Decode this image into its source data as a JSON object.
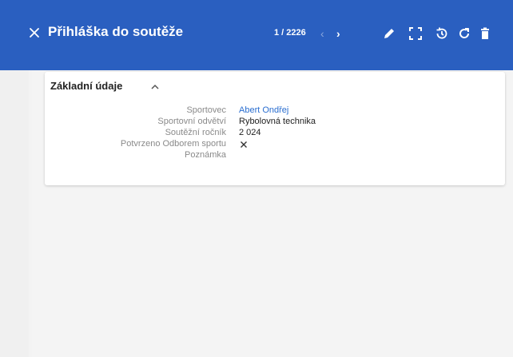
{
  "header": {
    "title": "Přihláška do soutěže",
    "counter": "1 / 2226",
    "prev_icon": "chevron-left-icon",
    "next_icon": "chevron-right-icon",
    "actions": [
      "edit-pencil-icon",
      "expand-icon",
      "history-icon",
      "refresh-icon",
      "delete-icon"
    ],
    "accent_color": "#2a5fc0"
  },
  "section": {
    "title": "Základní údaje",
    "toggle_icon": "chevron-up-icon",
    "rows": [
      {
        "label": "Sportovec",
        "value": "Abert Ondřej"
      },
      {
        "label": "Sportovní odvětví",
        "value": "Rybolovná technika"
      },
      {
        "label": "Soutěžní ročník",
        "value": "2 024"
      },
      {
        "label": "Potvrzeno Odborem sportu",
        "value": "",
        "value_icon": "cross-icon"
      },
      {
        "label": "Poznámka",
        "value": ""
      }
    ]
  },
  "colors": {
    "link": "#2a6ed0",
    "label": "#8a8a8a"
  }
}
